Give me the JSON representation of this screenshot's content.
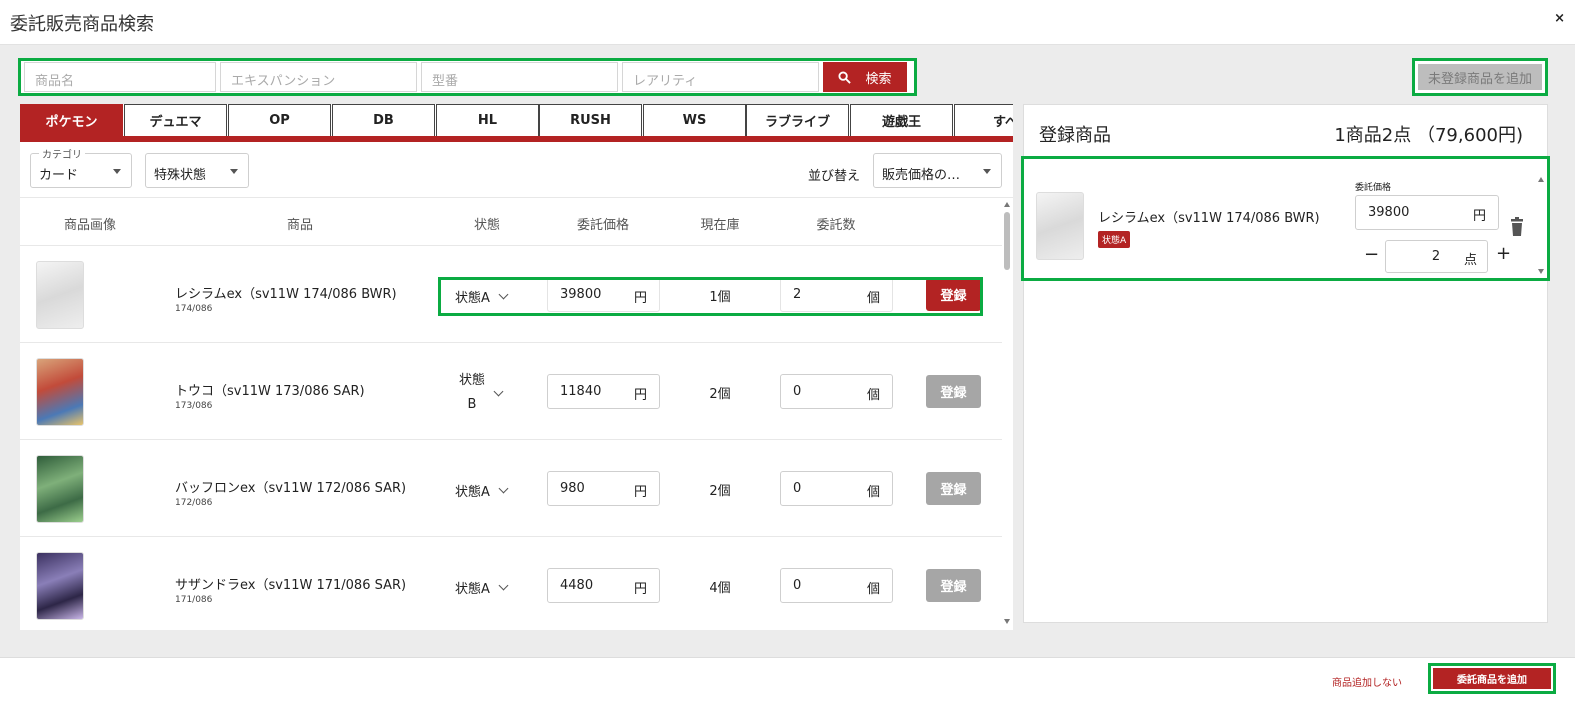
{
  "window": {
    "title": "委託販売商品検索",
    "close_label": "×"
  },
  "search": {
    "name_placeholder": "商品名",
    "expansion_placeholder": "エキスパンション",
    "model_placeholder": "型番",
    "rarity_placeholder": "レアリティ",
    "button_label": "検索"
  },
  "add_unregistered_label": "未登録商品を追加",
  "tabs": [
    {
      "label": "ポケモン",
      "active": true
    },
    {
      "label": "デュエマ"
    },
    {
      "label": "OP"
    },
    {
      "label": "DB"
    },
    {
      "label": "HL"
    },
    {
      "label": "RUSH"
    },
    {
      "label": "WS"
    },
    {
      "label": "ラブライブ"
    },
    {
      "label": "遊戯王"
    },
    {
      "label": "すべ"
    }
  ],
  "filters": {
    "category_legend": "カテゴリ",
    "category_value": "カード",
    "special_state": "特殊状態",
    "sort_label": "並び替え",
    "sort_value": "販売価格の…"
  },
  "table": {
    "headers": [
      "商品画像",
      "商品",
      "状態",
      "委託価格",
      "現在庫",
      "委託数"
    ],
    "price_unit": "円",
    "qty_unit": "個",
    "register_label": "登録",
    "rows": [
      {
        "name": "レシラムex（sv11W 174/086 BWR)",
        "number": "174/086",
        "condition": "状態A",
        "price": "39800",
        "stock": "1個",
        "qty": "2",
        "active": true
      },
      {
        "name": "トウコ（sv11W 173/086 SAR)",
        "number": "173/086",
        "condition": "状態B",
        "price": "11840",
        "stock": "2個",
        "qty": "0",
        "active": false
      },
      {
        "name": "バッフロンex（sv11W 172/086 SAR)",
        "number": "172/086",
        "condition": "状態A",
        "price": "980",
        "stock": "2個",
        "qty": "0",
        "active": false
      },
      {
        "name": "サザンドラex（sv11W 171/086 SAR)",
        "number": "171/086",
        "condition": "状態A",
        "price": "4480",
        "stock": "4個",
        "qty": "0",
        "active": false
      }
    ]
  },
  "registered": {
    "title": "登録商品",
    "summary": "1商品2点 （79,600円)",
    "items": [
      {
        "name": "レシラムex（sv11W 174/086 BWR)",
        "badge": "状態A",
        "price_label": "委託価格",
        "price": "39800",
        "price_unit": "円",
        "qty": "2",
        "qty_unit": "点"
      }
    ]
  },
  "footer": {
    "no_add_label": "商品追加しない",
    "add_label": "委託商品を追加"
  }
}
